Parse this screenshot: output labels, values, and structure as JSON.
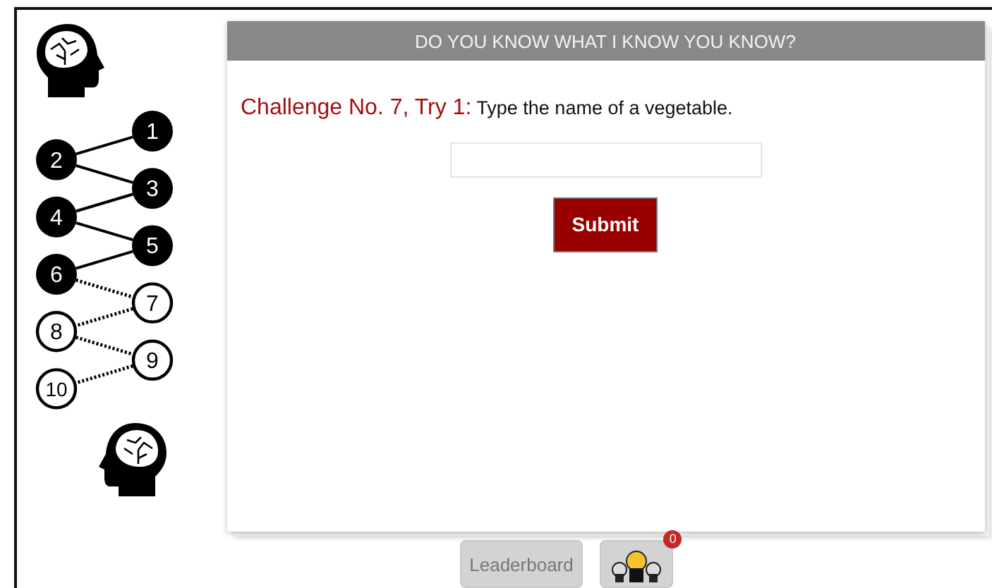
{
  "progress": [
    {
      "label": "1",
      "completed": true
    },
    {
      "label": "2",
      "completed": true
    },
    {
      "label": "3",
      "completed": true
    },
    {
      "label": "4",
      "completed": true
    },
    {
      "label": "5",
      "completed": true
    },
    {
      "label": "6",
      "completed": true
    },
    {
      "label": "7",
      "completed": false
    },
    {
      "label": "8",
      "completed": false
    },
    {
      "label": "9",
      "completed": false
    },
    {
      "label": "10",
      "completed": false
    }
  ],
  "card": {
    "title": "DO YOU KNOW WHAT I KNOW YOU KNOW?",
    "challenge": "**Challenge No. 7, Try 1:** Type the name of a vegetable.",
    "submit": "Submit"
  },
  "footer": {
    "leaderboard": "Leaderboard",
    "badge": "0"
  }
}
